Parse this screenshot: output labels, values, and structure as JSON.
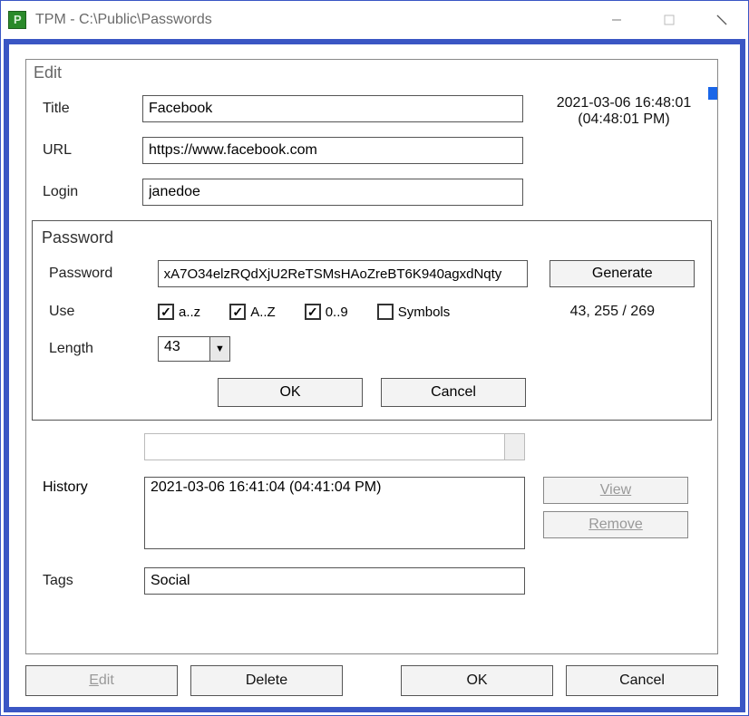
{
  "window": {
    "title": "TPM - C:\\Public\\Passwords"
  },
  "panel": {
    "title": "Edit"
  },
  "labels": {
    "title": "Title",
    "url": "URL",
    "login": "Login",
    "password_group": "Password",
    "password": "Password",
    "use": "Use",
    "length": "Length",
    "history": "History",
    "tags": "Tags"
  },
  "fields": {
    "title": "Facebook",
    "url": "https://www.facebook.com",
    "login": "janedoe",
    "password": "xA7O34elzRQdXjU2ReTSMsHAoZreBT6K940agxdNqty",
    "length": "43",
    "history": "2021-03-06 16:41:04 (04:41:04 PM)",
    "tags": "Social"
  },
  "timestamp": {
    "line1": "2021-03-06 16:48:01",
    "line2": "(04:48:01 PM)"
  },
  "checkboxes": {
    "az_label": "a..z",
    "AZ_label": "A..Z",
    "digits_label": "0..9",
    "symbols_label": "Symbols"
  },
  "stats": "43, 255 / 269",
  "buttons": {
    "generate": "Generate",
    "ok": "OK",
    "cancel": "Cancel",
    "view": "View",
    "remove": "Remove",
    "edit_prefix": "E",
    "edit_rest": "dit",
    "delete": "Delete"
  }
}
